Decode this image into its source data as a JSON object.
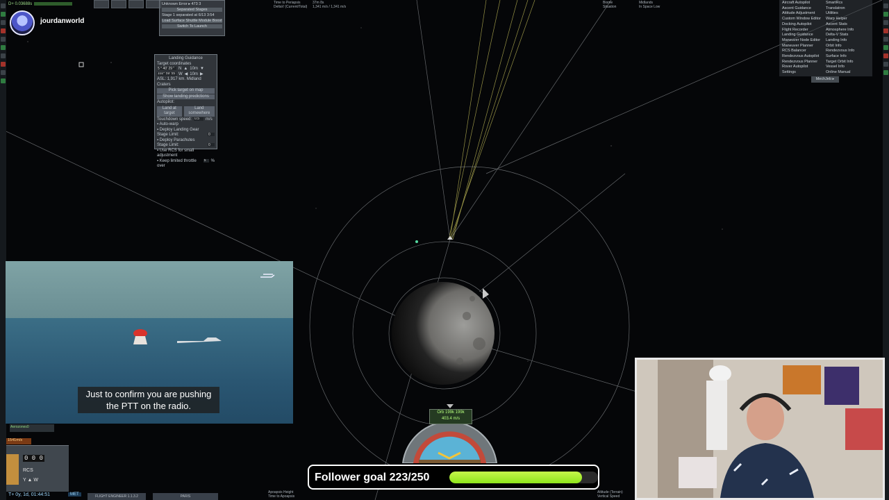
{
  "stream": {
    "username": "jourdanworld",
    "top_badge": "D+ 0.03688s"
  },
  "top_readouts": {
    "periapsis_label": "Time to Periapsis",
    "periapsis_value": "37m 8s",
    "deltav_label": "DeltaV (Current/Total)",
    "deltav_value": "1,341 m/s / 1,341 m/s",
    "biome_label": "Biome",
    "situation_label": "Situation",
    "biome_value": "Midlands",
    "situation_value": "In Space Low"
  },
  "separated_panel": {
    "line1": "Unknown Error ▸ 473 3",
    "line2": "Separated Stages",
    "line3": "Stage 1 separated at 6/13 3:54",
    "line4": "Load Surface Shuttle Module Boost",
    "line5": "Switch To Launch"
  },
  "landing_guidance": {
    "title": "Landing Guidance",
    "target_coords_label": "Target coordinates",
    "lat": "5 ° 40' 29 \"",
    "lat_dir": "N",
    "lon": "102° 59' 55 \"",
    "lon_dir": "W",
    "step1": "10m",
    "step2": "10m",
    "asl": "ASL: 1,917 km. Midland Craters",
    "pick_target": "Pick target on map",
    "show_predictions": "Show landing predictions",
    "autopilot_label": "Autopilot:",
    "land_at_target": "Land at target",
    "land_somewhere": "Land somewhere",
    "touchdown_label": "Touchdown speed:",
    "touchdown_value": "0.5",
    "touchdown_unit": "m/s",
    "auto_warp": "Auto-warp",
    "deploy_gear": "Deploy Landing Gear",
    "stage_limit_1": "Stage Limit:",
    "stage_limit_1_val": "0",
    "deploy_chutes": "Deploy Parachutes",
    "stage_limit_2": "Stage Limit:",
    "stage_limit_2_val": "0",
    "use_rcs": "Use RCS for small adjustment",
    "limit_throttle": "Keep limited throttle over",
    "limit_throttle_val": "5",
    "limit_throttle_unit": "%"
  },
  "mechjeb": {
    "left": [
      "Aircraft Autopilot",
      "Ascent Guidance",
      "Attitude Adjustment",
      "Custom Window Editor",
      "Docking Autopilot",
      "Flight Recorder",
      "Landing Guidance",
      "Maneuver Node Editor",
      "Maneuver Planner",
      "RCS Balancer",
      "Rendezvous Autopilot",
      "Rendezvous Planner",
      "Rover Autopilot",
      "Settings"
    ],
    "right": [
      "SmartRcs",
      "Translatron",
      "Utilities",
      "Warp Helper",
      "Ascent Stats",
      "Atmosphere Info",
      "Delta-V Stats",
      "Landing Info",
      "Orbit Info",
      "Rendezvous Info",
      "Surface Info",
      "Target Orbit Info",
      "Vessel Info",
      "Online Manual"
    ],
    "tab": "MechJeb ▸"
  },
  "lower_left": {
    "aero_tag": "Aerozones0",
    "speed": "1541m/s",
    "digits": "0 0 0",
    "rcs": "RCS",
    "yaw": "Y ▲ W",
    "met": "T+ 0y, 1d, 01:44:51",
    "met_label": "MET",
    "tab1": "FLIGHT ENGINEER 1.1.3.2",
    "tab2": "PARIS"
  },
  "video": {
    "caption_line1": "Just to confirm you are pushing",
    "caption_line2": "the PTT on the radio."
  },
  "follower_goal": {
    "label": "Follower goal 223/250",
    "current": 223,
    "target": 250,
    "fill_color": "#a8ee2c"
  },
  "navball": {
    "mode": "Orb 199k 199k",
    "speed": "403.4 m/s"
  },
  "bottom_readouts": {
    "left_label1": "Apoapsis Height",
    "left_label2": "Time to Apoapsis",
    "left_label3": "Periapsis Height",
    "right_label1": "Altitude (Terrain)",
    "right_label2": "Vertical Speed",
    "right_label3": "Horizontal Speed"
  },
  "colors": {
    "background": "#050608",
    "orbit": "#8e9296",
    "trajectory": "#c8c25a",
    "accent_green": "#a8ee2c"
  }
}
